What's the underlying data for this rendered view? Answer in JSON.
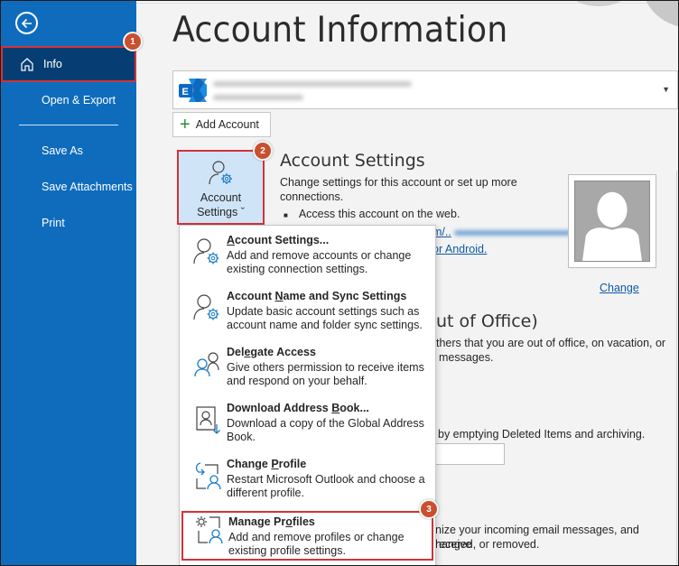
{
  "sidebar": {
    "back_label": "Back",
    "items": [
      {
        "label": "Info",
        "active": true
      },
      {
        "label": "Open & Export"
      },
      {
        "label": "Save As"
      },
      {
        "label": "Save Attachments"
      },
      {
        "label": "Print"
      }
    ]
  },
  "badges": [
    "1",
    "2",
    "3"
  ],
  "main": {
    "title": "Account Information",
    "account_type_icon": "exchange-icon",
    "add_account_label": "Add Account",
    "account_settings_button": {
      "line1": "Account",
      "line2": "Settings",
      "caret": "ˇ"
    },
    "account_settings": {
      "title": "Account Settings",
      "description": "Change settings for this account or set up more connections.",
      "bullet": "Access this account on the web.",
      "link_fragment_1": "m/..",
      "link_fragment_2": "or Android."
    },
    "photo_change_label": "Change",
    "auto_replies": {
      "title_fragment": "ut of Office)",
      "desc_line1": "thers that you are out of office, on vacation, or",
      "desc_line2": "messages."
    },
    "mailbox_cleanup": {
      "desc": "by emptying Deleted Items and archiving."
    },
    "rules": {
      "desc_line1": "nize your incoming email messages, and receive",
      "desc_line2": "hanged, or removed."
    }
  },
  "menu": {
    "items": [
      {
        "title_pre": "",
        "title_u": "A",
        "title_post": "ccount Settings...",
        "desc": "Add and remove accounts or change existing connection settings.",
        "icon": "account-settings-icon"
      },
      {
        "title_pre": "Account ",
        "title_u": "N",
        "title_post": "ame and Sync Settings",
        "desc": "Update basic account settings such as account name and folder sync settings.",
        "icon": "account-sync-icon"
      },
      {
        "title_pre": "Del",
        "title_u": "e",
        "title_post": "gate Access",
        "desc": "Give others permission to receive items and respond on your behalf.",
        "icon": "delegate-icon"
      },
      {
        "title_pre": "Download Address ",
        "title_u": "B",
        "title_post": "ook...",
        "desc": "Download a copy of the Global Address Book.",
        "icon": "address-book-icon"
      },
      {
        "title_pre": "Change ",
        "title_u": "P",
        "title_post": "rofile",
        "desc": "Restart Microsoft Outlook and choose a different profile.",
        "icon": "change-profile-icon"
      },
      {
        "title_pre": "Manage Pr",
        "title_u": "o",
        "title_post": "files",
        "desc": "Add and remove profiles or change existing profile settings.",
        "icon": "manage-profiles-icon"
      }
    ]
  },
  "colors": {
    "sidebar": "#0f6cbd",
    "sidebar_active": "#063e73",
    "highlight": "#d13438",
    "badge": "#c8502f",
    "link": "#0f5aa8"
  }
}
